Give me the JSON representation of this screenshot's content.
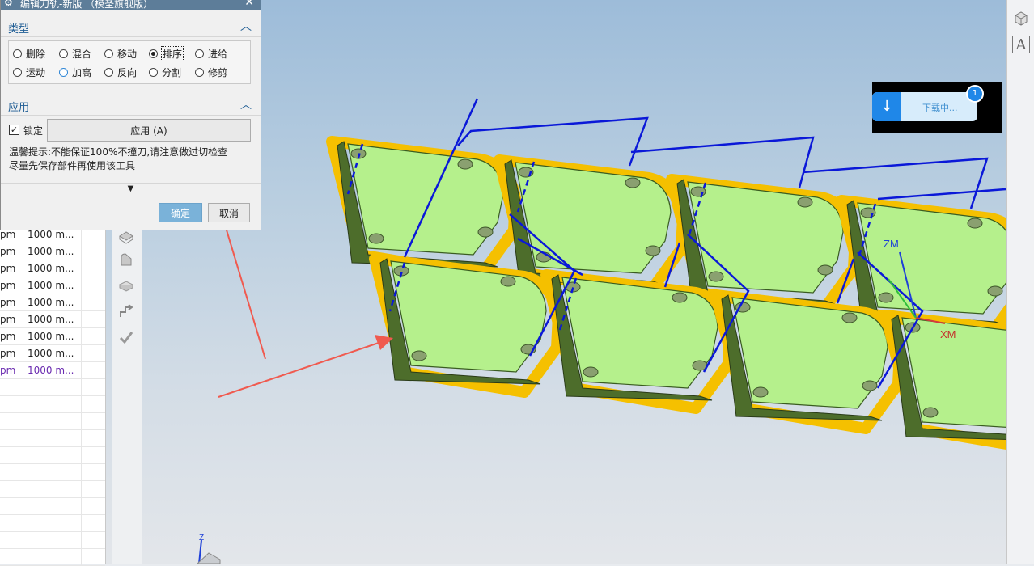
{
  "dialog": {
    "title": "编辑刀轨-新版 （模圣旗舰版）",
    "close_glyph": "✕",
    "type_section": {
      "label": "类型",
      "options": [
        {
          "label": "删除",
          "selected": false
        },
        {
          "label": "混合",
          "selected": false
        },
        {
          "label": "移动",
          "selected": false
        },
        {
          "label": "排序",
          "selected": true
        },
        {
          "label": "进给",
          "selected": false
        },
        {
          "label": "运动",
          "selected": false
        },
        {
          "label": "加高",
          "selected": false
        },
        {
          "label": "反向",
          "selected": false
        },
        {
          "label": "分割",
          "selected": false
        },
        {
          "label": "修剪",
          "selected": false
        }
      ]
    },
    "apply_section": {
      "label": "应用",
      "lock_label": "锁定",
      "lock_checked": true,
      "apply_button": "应用 (A)",
      "hint_line1": "温馨提示:不能保证100%不撞刀,请注意做过切检查",
      "hint_line2": "尽量先保存部件再使用该工具"
    },
    "expand_glyph": "▼",
    "ok_button": "确定",
    "cancel_button": "取消"
  },
  "table": {
    "rows": [
      {
        "c1": "pm",
        "c2": "1000 m..."
      },
      {
        "c1": "pm",
        "c2": "1000 m..."
      },
      {
        "c1": "pm",
        "c2": "1000 m..."
      },
      {
        "c1": "pm",
        "c2": "1000 m..."
      },
      {
        "c1": "pm",
        "c2": "1000 m..."
      },
      {
        "c1": "pm",
        "c2": "1000 m..."
      },
      {
        "c1": "pm",
        "c2": "1000 m..."
      },
      {
        "c1": "pm",
        "c2": "1000 m..."
      },
      {
        "c1": "pm",
        "c2": "1000 m...",
        "selected": true
      }
    ],
    "empty_rows": 11
  },
  "viewport": {
    "axis_zm": "ZM",
    "axis_xm": "XM",
    "axis_z_small": "Z",
    "annotation_color": "#f05a4f",
    "toolpath_color": "#0a18d8",
    "part_fill": "#b5f08c",
    "outline_color": "#f5c000"
  },
  "download": {
    "label": "下载中...",
    "badge": "1",
    "arrow_glyph": "↓"
  },
  "right_toolbar": {
    "font_tool_glyph": "A"
  }
}
